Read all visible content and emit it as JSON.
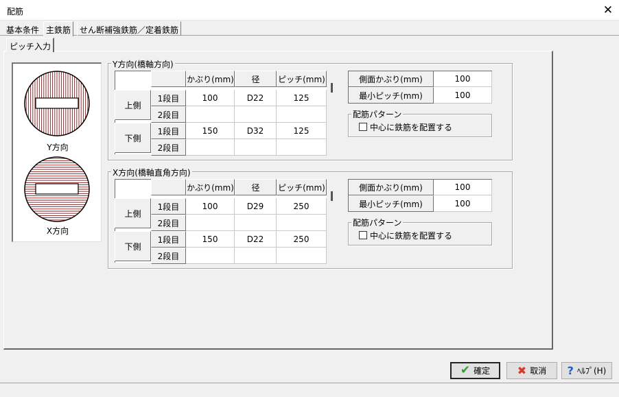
{
  "window": {
    "title": "配筋",
    "close_glyph": "✕"
  },
  "tabs": [
    "基本条件",
    "主鉄筋",
    "せん断補強鉄筋／定着鉄筋"
  ],
  "selected_tab": 1,
  "subtab": "ピッチ入力",
  "diagram": {
    "y_label": "Y方向",
    "x_label": "X方向"
  },
  "y_section": {
    "title": "Y方向(橋軸方向)",
    "headers": [
      "かぶり(mm)",
      "径",
      "ピッチ(mm)"
    ],
    "groups": [
      {
        "name": "上側",
        "rows": [
          {
            "label": "1段目",
            "cover": "100",
            "dia": "D22",
            "pitch": "125"
          },
          {
            "label": "2段目",
            "cover": "",
            "dia": "",
            "pitch": ""
          }
        ]
      },
      {
        "name": "下側",
        "rows": [
          {
            "label": "1段目",
            "cover": "150",
            "dia": "D32",
            "pitch": "125"
          },
          {
            "label": "2段目",
            "cover": "",
            "dia": "",
            "pitch": ""
          }
        ]
      }
    ],
    "side_cover_label": "側面かぶり(mm)",
    "side_cover": "100",
    "min_pitch_label": "最小ピッチ(mm)",
    "min_pitch": "100",
    "pattern_title": "配筋パターン",
    "center_check_label": "中心に鉄筋を配置する"
  },
  "x_section": {
    "title": "X方向(橋軸直角方向)",
    "headers": [
      "かぶり(mm)",
      "径",
      "ピッチ(mm)"
    ],
    "groups": [
      {
        "name": "上側",
        "rows": [
          {
            "label": "1段目",
            "cover": "100",
            "dia": "D29",
            "pitch": "250"
          },
          {
            "label": "2段目",
            "cover": "",
            "dia": "",
            "pitch": ""
          }
        ]
      },
      {
        "name": "下側",
        "rows": [
          {
            "label": "1段目",
            "cover": "150",
            "dia": "D22",
            "pitch": "250"
          },
          {
            "label": "2段目",
            "cover": "",
            "dia": "",
            "pitch": ""
          }
        ]
      }
    ],
    "side_cover_label": "側面かぶり(mm)",
    "side_cover": "100",
    "min_pitch_label": "最小ピッチ(mm)",
    "min_pitch": "100",
    "pattern_title": "配筋パターン",
    "center_check_label": "中心に鉄筋を配置する"
  },
  "buttons": {
    "ok": "確定",
    "cancel": "取消",
    "help": "ﾍﾙﾌﾟ(H)"
  },
  "colors": {
    "ok_check": "#2e9e2e",
    "cancel_x": "#d23b2b",
    "help_q": "#1f5fc4",
    "hatch": "#8a1a1a"
  }
}
